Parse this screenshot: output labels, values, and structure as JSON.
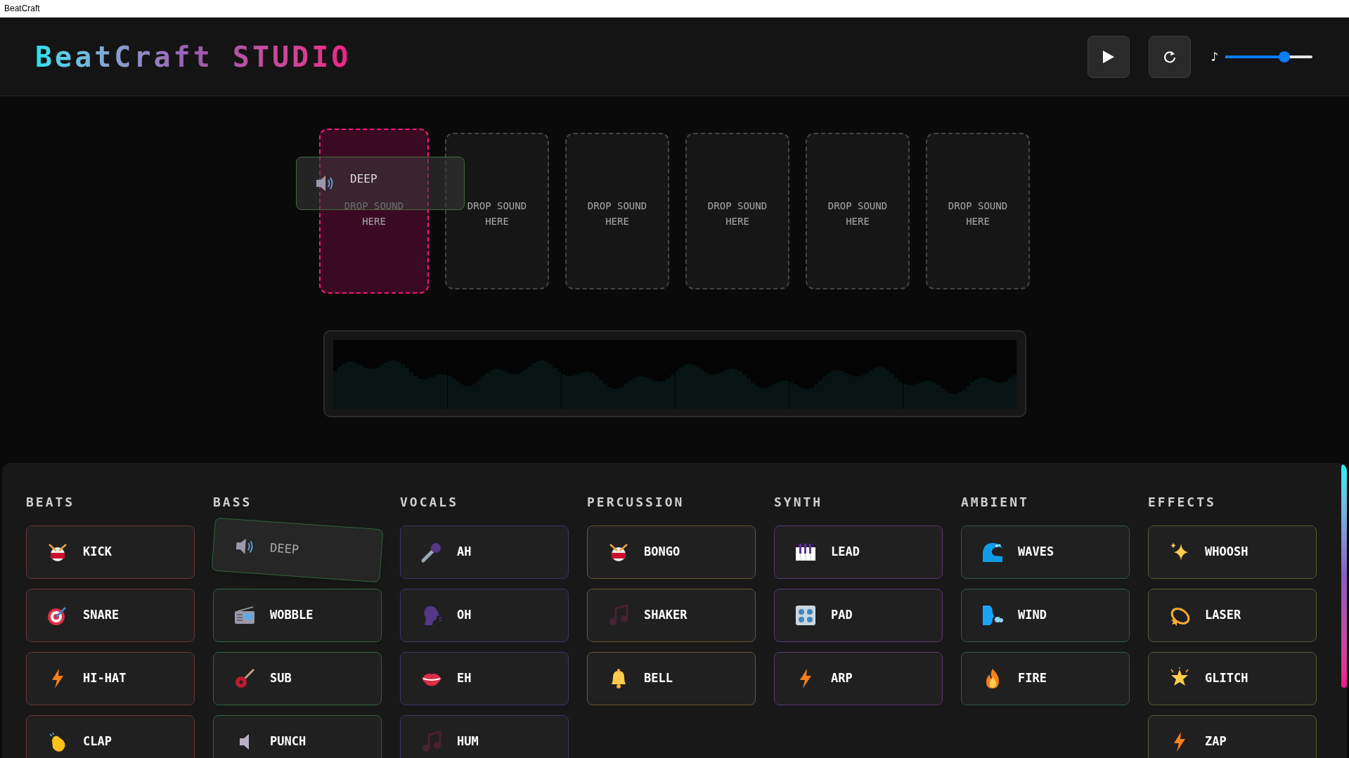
{
  "window": {
    "title": "BeatCraft"
  },
  "header": {
    "title": "BeatCraft STUDIO",
    "volume": {
      "glyph": "♪",
      "level": 0.68
    }
  },
  "slots": [
    {
      "label": "DROP SOUND HERE",
      "drop_target": true
    },
    {
      "label": "DROP SOUND HERE",
      "drop_target": false
    },
    {
      "label": "DROP SOUND HERE",
      "drop_target": false
    },
    {
      "label": "DROP SOUND HERE",
      "drop_target": false
    },
    {
      "label": "DROP SOUND HERE",
      "drop_target": false
    },
    {
      "label": "DROP SOUND HERE",
      "drop_target": false
    }
  ],
  "drag_preview": {
    "label": "DEEP"
  },
  "library": [
    {
      "name": "BEATS",
      "color": "#6b3434",
      "sounds": [
        {
          "label": "KICK",
          "dragging": false
        },
        {
          "label": "SNARE",
          "dragging": false
        },
        {
          "label": "HI-HAT",
          "dragging": false
        },
        {
          "label": "CLAP",
          "dragging": false
        }
      ]
    },
    {
      "name": "BASS",
      "color": "#30643a",
      "sounds": [
        {
          "label": "DEEP",
          "dragging": true
        },
        {
          "label": "WOBBLE",
          "dragging": false
        },
        {
          "label": "SUB",
          "dragging": false
        },
        {
          "label": "PUNCH",
          "dragging": false
        }
      ]
    },
    {
      "name": "VOCALS",
      "color": "#3b3668",
      "sounds": [
        {
          "label": "AH",
          "dragging": false
        },
        {
          "label": "OH",
          "dragging": false
        },
        {
          "label": "EH",
          "dragging": false
        },
        {
          "label": "HUM",
          "dragging": false
        }
      ]
    },
    {
      "name": "PERCUSSION",
      "color": "#6b5a30",
      "sounds": [
        {
          "label": "BONGO",
          "dragging": false
        },
        {
          "label": "SHAKER",
          "dragging": false
        },
        {
          "label": "BELL",
          "dragging": false
        }
      ]
    },
    {
      "name": "SYNTH",
      "color": "#5b3672",
      "sounds": [
        {
          "label": "LEAD",
          "dragging": false
        },
        {
          "label": "PAD",
          "dragging": false
        },
        {
          "label": "ARP",
          "dragging": false
        }
      ]
    },
    {
      "name": "AMBIENT",
      "color": "#2f5855",
      "sounds": [
        {
          "label": "WAVES",
          "dragging": false
        },
        {
          "label": "WIND",
          "dragging": false
        },
        {
          "label": "FIRE",
          "dragging": false
        }
      ]
    },
    {
      "name": "EFFECTS",
      "color": "#5e5a2f",
      "sounds": [
        {
          "label": "WHOOSH",
          "dragging": false
        },
        {
          "label": "LASER",
          "dragging": false
        },
        {
          "label": "GLITCH",
          "dragging": false
        },
        {
          "label": "ZAP",
          "dragging": false
        }
      ]
    }
  ]
}
